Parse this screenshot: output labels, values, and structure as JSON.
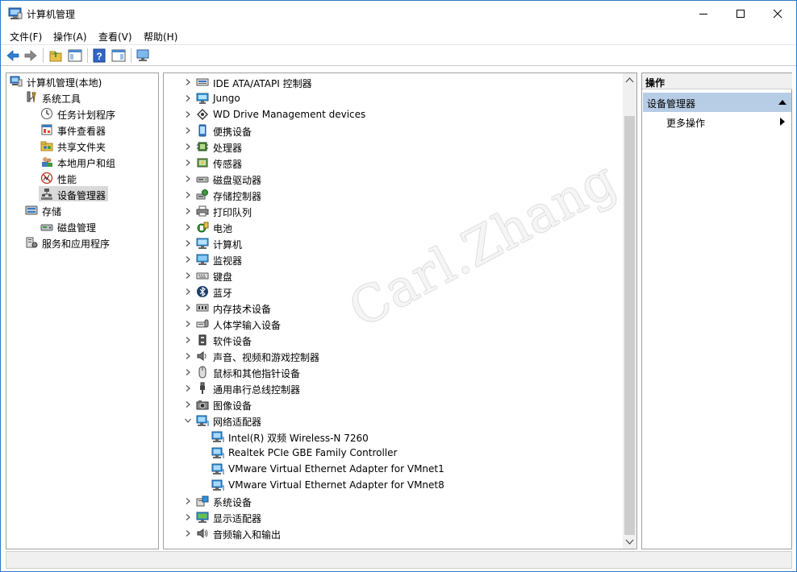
{
  "window": {
    "title": "计算机管理"
  },
  "menu": [
    "文件(F)",
    "操作(A)",
    "查看(V)",
    "帮助(H)"
  ],
  "left_tree": [
    {
      "label": "计算机管理(本地)",
      "level": 0,
      "expand": "none",
      "icon": "computer-management-icon"
    },
    {
      "label": "系统工具",
      "level": 1,
      "expand": "open",
      "icon": "system-tools-icon"
    },
    {
      "label": "任务计划程序",
      "level": 2,
      "expand": "closed",
      "icon": "task-scheduler-icon"
    },
    {
      "label": "事件查看器",
      "level": 2,
      "expand": "closed",
      "icon": "event-viewer-icon"
    },
    {
      "label": "共享文件夹",
      "level": 2,
      "expand": "closed",
      "icon": "shared-folders-icon"
    },
    {
      "label": "本地用户和组",
      "level": 2,
      "expand": "closed",
      "icon": "local-users-icon"
    },
    {
      "label": "性能",
      "level": 2,
      "expand": "closed",
      "icon": "performance-icon"
    },
    {
      "label": "设备管理器",
      "level": 2,
      "expand": "none",
      "icon": "device-manager-icon",
      "selected": true
    },
    {
      "label": "存储",
      "level": 1,
      "expand": "open",
      "icon": "storage-icon"
    },
    {
      "label": "磁盘管理",
      "level": 2,
      "expand": "none",
      "icon": "disk-management-icon"
    },
    {
      "label": "服务和应用程序",
      "level": 1,
      "expand": "closed",
      "icon": "services-apps-icon"
    }
  ],
  "device_tree": [
    {
      "label": "IDE ATA/ATAPI 控制器",
      "level": 0,
      "expand": "closed",
      "icon": "ide-controller-icon"
    },
    {
      "label": "Jungo",
      "level": 0,
      "expand": "closed",
      "icon": "jungo-icon"
    },
    {
      "label": "WD Drive Management devices",
      "level": 0,
      "expand": "closed",
      "icon": "wd-devices-icon"
    },
    {
      "label": "便携设备",
      "level": 0,
      "expand": "closed",
      "icon": "portable-devices-icon"
    },
    {
      "label": "处理器",
      "level": 0,
      "expand": "closed",
      "icon": "processor-icon"
    },
    {
      "label": "传感器",
      "level": 0,
      "expand": "closed",
      "icon": "sensor-icon"
    },
    {
      "label": "磁盘驱动器",
      "level": 0,
      "expand": "closed",
      "icon": "disk-drive-icon"
    },
    {
      "label": "存储控制器",
      "level": 0,
      "expand": "closed",
      "icon": "storage-controller-icon"
    },
    {
      "label": "打印队列",
      "level": 0,
      "expand": "closed",
      "icon": "print-queue-icon"
    },
    {
      "label": "电池",
      "level": 0,
      "expand": "closed",
      "icon": "battery-icon"
    },
    {
      "label": "计算机",
      "level": 0,
      "expand": "closed",
      "icon": "computer-icon"
    },
    {
      "label": "监视器",
      "level": 0,
      "expand": "closed",
      "icon": "monitor-icon"
    },
    {
      "label": "键盘",
      "level": 0,
      "expand": "closed",
      "icon": "keyboard-icon"
    },
    {
      "label": "蓝牙",
      "level": 0,
      "expand": "closed",
      "icon": "bluetooth-icon"
    },
    {
      "label": "内存技术设备",
      "level": 0,
      "expand": "closed",
      "icon": "memory-device-icon"
    },
    {
      "label": "人体学输入设备",
      "level": 0,
      "expand": "closed",
      "icon": "hid-icon"
    },
    {
      "label": "软件设备",
      "level": 0,
      "expand": "closed",
      "icon": "software-device-icon"
    },
    {
      "label": "声音、视频和游戏控制器",
      "level": 0,
      "expand": "closed",
      "icon": "sound-icon"
    },
    {
      "label": "鼠标和其他指针设备",
      "level": 0,
      "expand": "closed",
      "icon": "mouse-icon"
    },
    {
      "label": "通用串行总线控制器",
      "level": 0,
      "expand": "closed",
      "icon": "usb-icon"
    },
    {
      "label": "图像设备",
      "level": 0,
      "expand": "closed",
      "icon": "imaging-device-icon"
    },
    {
      "label": "网络适配器",
      "level": 0,
      "expand": "open",
      "icon": "network-adapter-icon"
    },
    {
      "label": "Intel(R) 双频 Wireless-N 7260",
      "level": 1,
      "expand": "none",
      "icon": "network-adapter-icon"
    },
    {
      "label": "Realtek PCIe GBE Family Controller",
      "level": 1,
      "expand": "none",
      "icon": "network-adapter-icon"
    },
    {
      "label": "VMware Virtual Ethernet Adapter for VMnet1",
      "level": 1,
      "expand": "none",
      "icon": "network-adapter-icon"
    },
    {
      "label": "VMware Virtual Ethernet Adapter for VMnet8",
      "level": 1,
      "expand": "none",
      "icon": "network-adapter-icon"
    },
    {
      "label": "系统设备",
      "level": 0,
      "expand": "closed",
      "icon": "system-device-icon"
    },
    {
      "label": "显示适配器",
      "level": 0,
      "expand": "closed",
      "icon": "display-adapter-icon"
    },
    {
      "label": "音频输入和输出",
      "level": 0,
      "expand": "closed",
      "icon": "audio-io-icon"
    }
  ],
  "actions": {
    "header": "操作",
    "section": "设备管理器",
    "more": "更多操作"
  },
  "watermark": "Carl.Zhang",
  "colors": {
    "accent_border": "#2b7ac9",
    "selection": "#d9d9d9",
    "action_section": "#b7cde6"
  }
}
